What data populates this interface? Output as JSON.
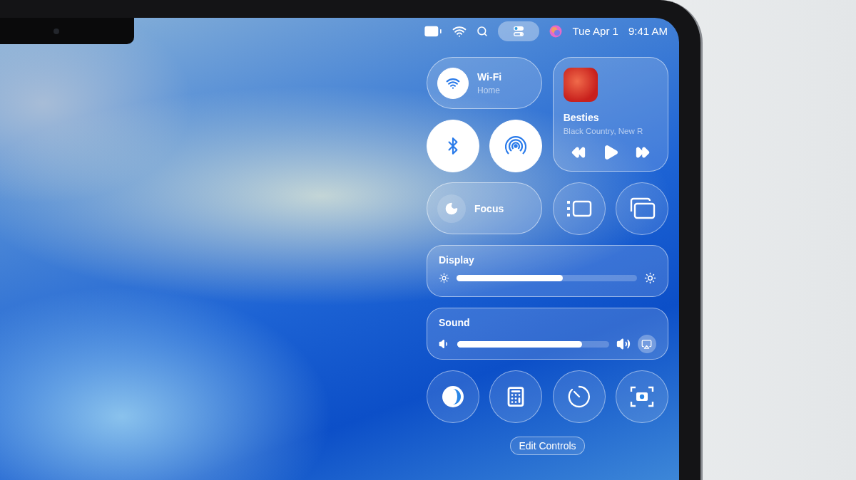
{
  "menu_bar": {
    "control_center_selected": true,
    "date": "Tue Apr 1",
    "time": "9:41 AM"
  },
  "control_center": {
    "wifi": {
      "title": "Wi-Fi",
      "subtitle": "Home",
      "on": true
    },
    "now_playing": {
      "title": "Besties",
      "artist": "Black Country, New R"
    },
    "bluetooth": {
      "on": true
    },
    "airdrop": {
      "on": true
    },
    "focus": {
      "label": "Focus",
      "on": false
    },
    "sliders": [
      {
        "kind": "display",
        "label": "Display",
        "level": 0.59
      },
      {
        "kind": "sound",
        "label": "Sound",
        "level": 0.82
      }
    ],
    "edit_button": "Edit Controls"
  }
}
